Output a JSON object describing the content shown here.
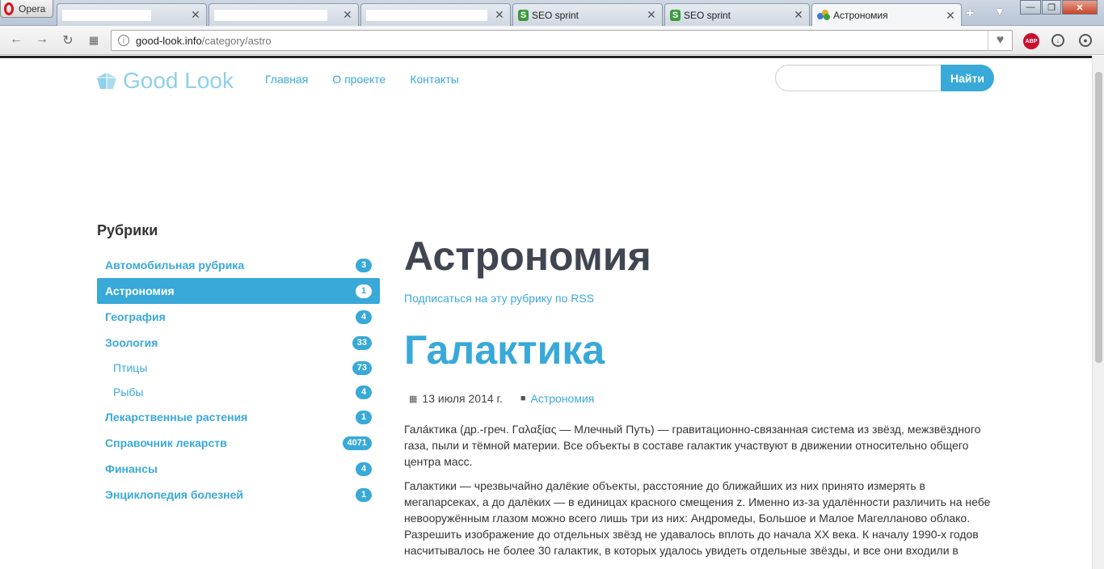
{
  "browser": {
    "opera_label": "Opera",
    "tabs": [
      {
        "label": "",
        "redacted": true
      },
      {
        "label": "",
        "redacted": true
      },
      {
        "label": "",
        "redacted": true
      },
      {
        "label": "SEO sprint"
      },
      {
        "label": "SEO sprint"
      },
      {
        "label": "Астрономия",
        "active": true
      }
    ],
    "url_host": "good-look.info",
    "url_path": "/category/astro"
  },
  "header": {
    "logo": "Good Look",
    "nav": [
      "Главная",
      "О проекте",
      "Контакты"
    ],
    "search_placeholder": "",
    "search_button": "Найти"
  },
  "sidebar": {
    "title": "Рубрики",
    "items": [
      {
        "label": "Автомобильная рубрика",
        "count": "3"
      },
      {
        "label": "Астрономия",
        "count": "1",
        "active": true
      },
      {
        "label": "География",
        "count": "4"
      },
      {
        "label": "Зоология",
        "count": "33"
      },
      {
        "label": "Птицы",
        "count": "73",
        "sub": true
      },
      {
        "label": "Рыбы",
        "count": "4",
        "sub": true
      },
      {
        "label": "Лекарственные растения",
        "count": "1"
      },
      {
        "label": "Справочник лекарств",
        "count": "4071"
      },
      {
        "label": "Финансы",
        "count": "4"
      },
      {
        "label": "Энциклопедия болезней",
        "count": "1"
      }
    ]
  },
  "main": {
    "page_title": "Астрономия",
    "rss_link": "Подписаться на эту рубрику по RSS",
    "post": {
      "title": "Галактика",
      "date": "13 июля 2014 г.",
      "category": "Астрономия",
      "paragraphs": [
        "Гала́ктика (др.-греч. Γαλαξίας — Млечный Путь) — гравитационно-связанная система из звёзд, межзвёздного газа, пыли и тёмной материи. Все объекты в составе галактик участвуют в движении относительно общего центра масс.",
        "Галактики — чрезвычайно далёкие объекты, расстояние до ближайших из них принято измерять в мегапарсеках, а до далёких — в единицах красного смещения z. Именно из-за удалённости различить на небе невооружённым глазом можно всего лишь три из них: Андромеды, Большое и Малое Магелланово облако. Разрешить изображение до отдельных звёзд не удавалось вплоть до начала XX века. К началу 1990-х годов насчитывалось не более 30 галактик, в которых удалось увидеть отдельные звёзды, и все они входили в"
      ]
    }
  },
  "colors": {
    "accent": "#38a9d8",
    "title_dark": "#3f4551"
  }
}
